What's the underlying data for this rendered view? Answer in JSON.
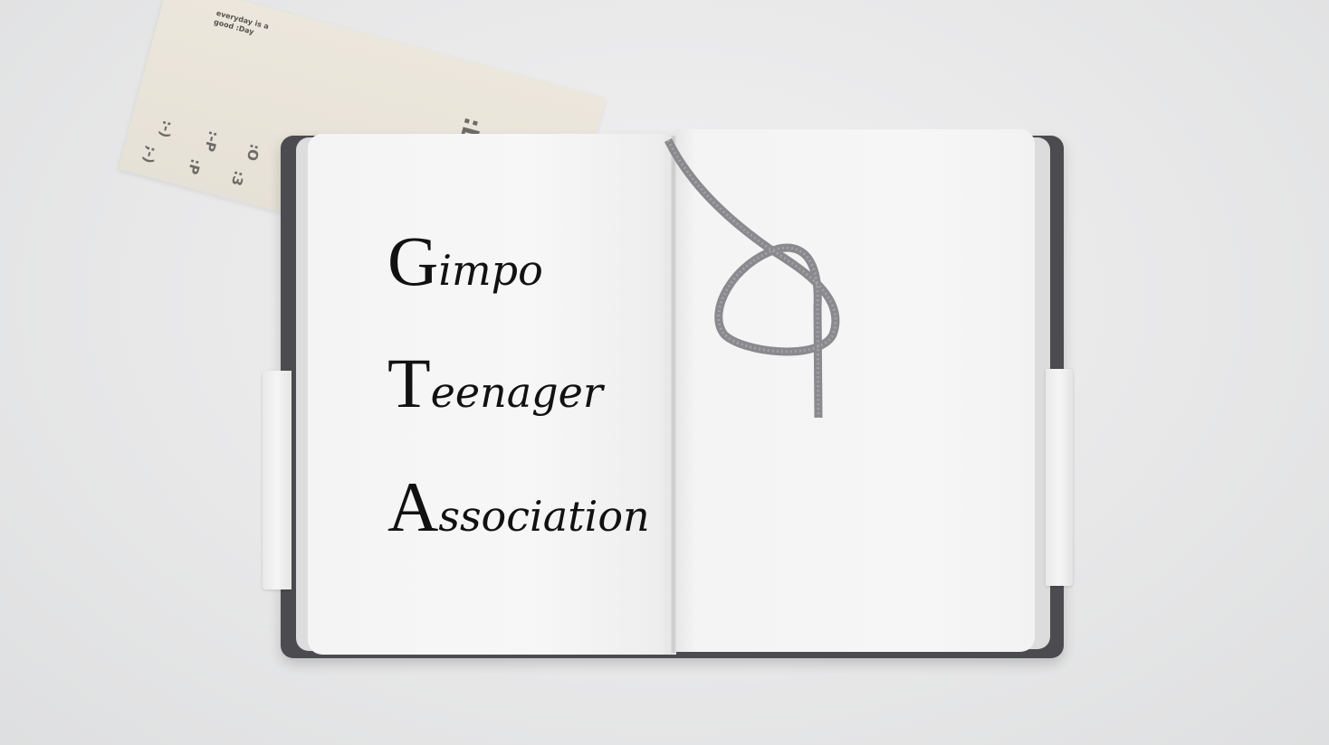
{
  "postcard": {
    "tagline_line1": "everyday is a",
    "tagline_line2": "good :Day",
    "big_face": ":D",
    "emoticons": [
      ":-)",
      ":-P",
      ":O",
      ";-)",
      ":P",
      ":3"
    ]
  },
  "title": {
    "lines": [
      {
        "initial": "G",
        "rest": "impo"
      },
      {
        "initial": "T",
        "rest": "eenager"
      },
      {
        "initial": "A",
        "rest": "ssociation"
      }
    ]
  },
  "colors": {
    "background": "#e9e9ea",
    "cover": "#4c4b4f",
    "page": "#f6f6f6",
    "ribbon": "#8a8a8e",
    "card": "#e8e3d8",
    "text": "#111111"
  }
}
